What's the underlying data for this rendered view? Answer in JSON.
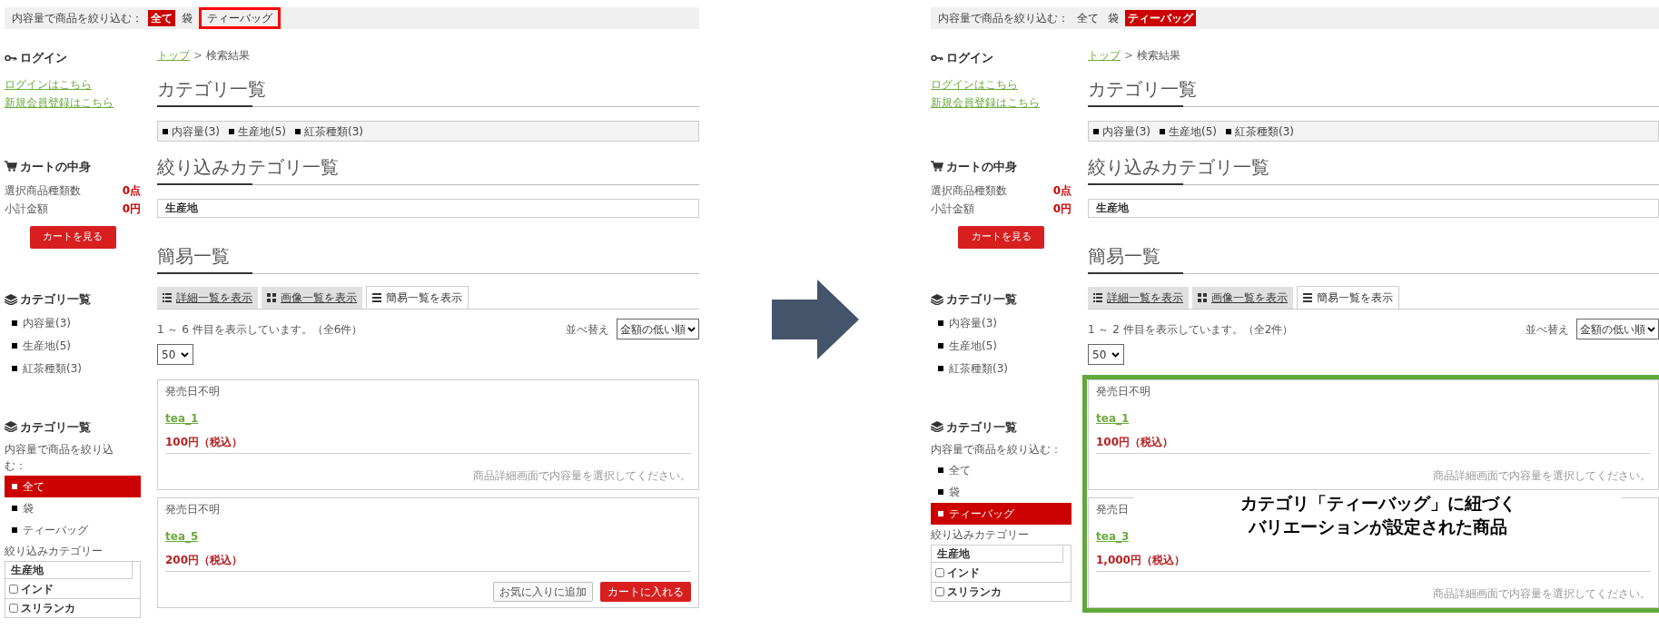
{
  "panels": [
    {
      "filter_bar": {
        "label": "内容量で商品を絞り込む：",
        "options": [
          {
            "label": "全て",
            "selected": true,
            "outlined": false
          },
          {
            "label": "袋",
            "selected": false,
            "outlined": false
          },
          {
            "label": "ティーバッグ",
            "selected": false,
            "outlined": true
          }
        ]
      },
      "login": {
        "title": "ログイン",
        "links": [
          "ログインはこちら",
          "新規会員登録はこちら"
        ]
      },
      "cart": {
        "title": "カートの中身",
        "rows": [
          {
            "label": "選択商品種類数",
            "value": "0点"
          },
          {
            "label": "小計金額",
            "value": "0円"
          }
        ],
        "button": "カートを見る"
      },
      "categories": {
        "title": "カテゴリ一覧",
        "items": [
          "内容量(3)",
          "生産地(5)",
          "紅茶種類(3)"
        ]
      },
      "refine": {
        "title": "カテゴリ一覧",
        "label": "内容量で商品を絞り込む：",
        "options": [
          {
            "label": "全て",
            "selected": true
          },
          {
            "label": "袋",
            "selected": false
          },
          {
            "label": "ティーバッグ",
            "selected": false
          }
        ],
        "subtitle": "絞り込みカテゴリー",
        "group": "生産地",
        "checkboxes": [
          {
            "label": "インド",
            "checked": false
          },
          {
            "label": "スリランカ",
            "checked": false
          }
        ]
      },
      "breadcrumb": {
        "link": "トップ",
        "separator": ">",
        "current": "検索結果"
      },
      "category_heading": "カテゴリ一覧",
      "category_chips": [
        "内容量(3)",
        "生産地(5)",
        "紅茶種類(3)"
      ],
      "filter_heading": "絞り込みカテゴリ一覧",
      "filter_value": "生産地",
      "list_heading": "簡易一覧",
      "view_tabs": [
        {
          "label": "詳細一覧を表示",
          "selected": false
        },
        {
          "label": "画像一覧を表示",
          "selected": false
        },
        {
          "label": "簡易一覧を表示",
          "selected": true
        }
      ],
      "result_count": "1 ～ 6 件目を表示しています。（全6件）",
      "sort_label": "並べ替え",
      "sort_value": "金額の低い順",
      "per_page": "50",
      "highlighted": false,
      "products": [
        {
          "date": "発売日不明",
          "name": "tea_1",
          "price": "100円（税込）",
          "note": "商品詳細画面で内容量を選択してください。"
        },
        {
          "date": "発売日不明",
          "name": "tea_5",
          "price": "200円（税込）",
          "buttons": [
            "お気に入りに追加",
            "カートに入れる"
          ]
        }
      ]
    },
    {
      "filter_bar": {
        "label": "内容量で商品を絞り込む：",
        "options": [
          {
            "label": "全て",
            "selected": false,
            "outlined": false
          },
          {
            "label": "袋",
            "selected": false,
            "outlined": false
          },
          {
            "label": "ティーバッグ",
            "selected": true,
            "outlined": false
          }
        ]
      },
      "login": {
        "title": "ログイン",
        "links": [
          "ログインはこちら",
          "新規会員登録はこちら"
        ]
      },
      "cart": {
        "title": "カートの中身",
        "rows": [
          {
            "label": "選択商品種類数",
            "value": "0点"
          },
          {
            "label": "小計金額",
            "value": "0円"
          }
        ],
        "button": "カートを見る"
      },
      "categories": {
        "title": "カテゴリ一覧",
        "items": [
          "内容量(3)",
          "生産地(5)",
          "紅茶種類(3)"
        ]
      },
      "refine": {
        "title": "カテゴリ一覧",
        "label": "内容量で商品を絞り込む：",
        "options": [
          {
            "label": "全て",
            "selected": false
          },
          {
            "label": "袋",
            "selected": false
          },
          {
            "label": "ティーバッグ",
            "selected": true
          }
        ],
        "subtitle": "絞り込みカテゴリー",
        "group": "生産地",
        "checkboxes": [
          {
            "label": "インド",
            "checked": false
          },
          {
            "label": "スリランカ",
            "checked": false
          }
        ]
      },
      "breadcrumb": {
        "link": "トップ",
        "separator": ">",
        "current": "検索結果"
      },
      "category_heading": "カテゴリ一覧",
      "category_chips": [
        "内容量(3)",
        "生産地(5)",
        "紅茶種類(3)"
      ],
      "filter_heading": "絞り込みカテゴリ一覧",
      "filter_value": "生産地",
      "list_heading": "簡易一覧",
      "view_tabs": [
        {
          "label": "詳細一覧を表示",
          "selected": false
        },
        {
          "label": "画像一覧を表示",
          "selected": false
        },
        {
          "label": "簡易一覧を表示",
          "selected": true
        }
      ],
      "result_count": "1 ～ 2 件目を表示しています。（全2件）",
      "sort_label": "並べ替え",
      "sort_value": "金額の低い順",
      "per_page": "50",
      "highlighted": true,
      "annotation": [
        "カテゴリ「ティーバッグ」に紐づく",
        "バリエーションが設定された商品"
      ],
      "products": [
        {
          "date": "発売日不明",
          "name": "tea_1",
          "price": "100円（税込）",
          "note": "商品詳細画面で内容量を選択してください。"
        },
        {
          "date": "発売日",
          "name": "tea_3",
          "price": "1,000円（税込）",
          "note": "商品詳細画面で内容量を選択してください。"
        }
      ]
    }
  ]
}
